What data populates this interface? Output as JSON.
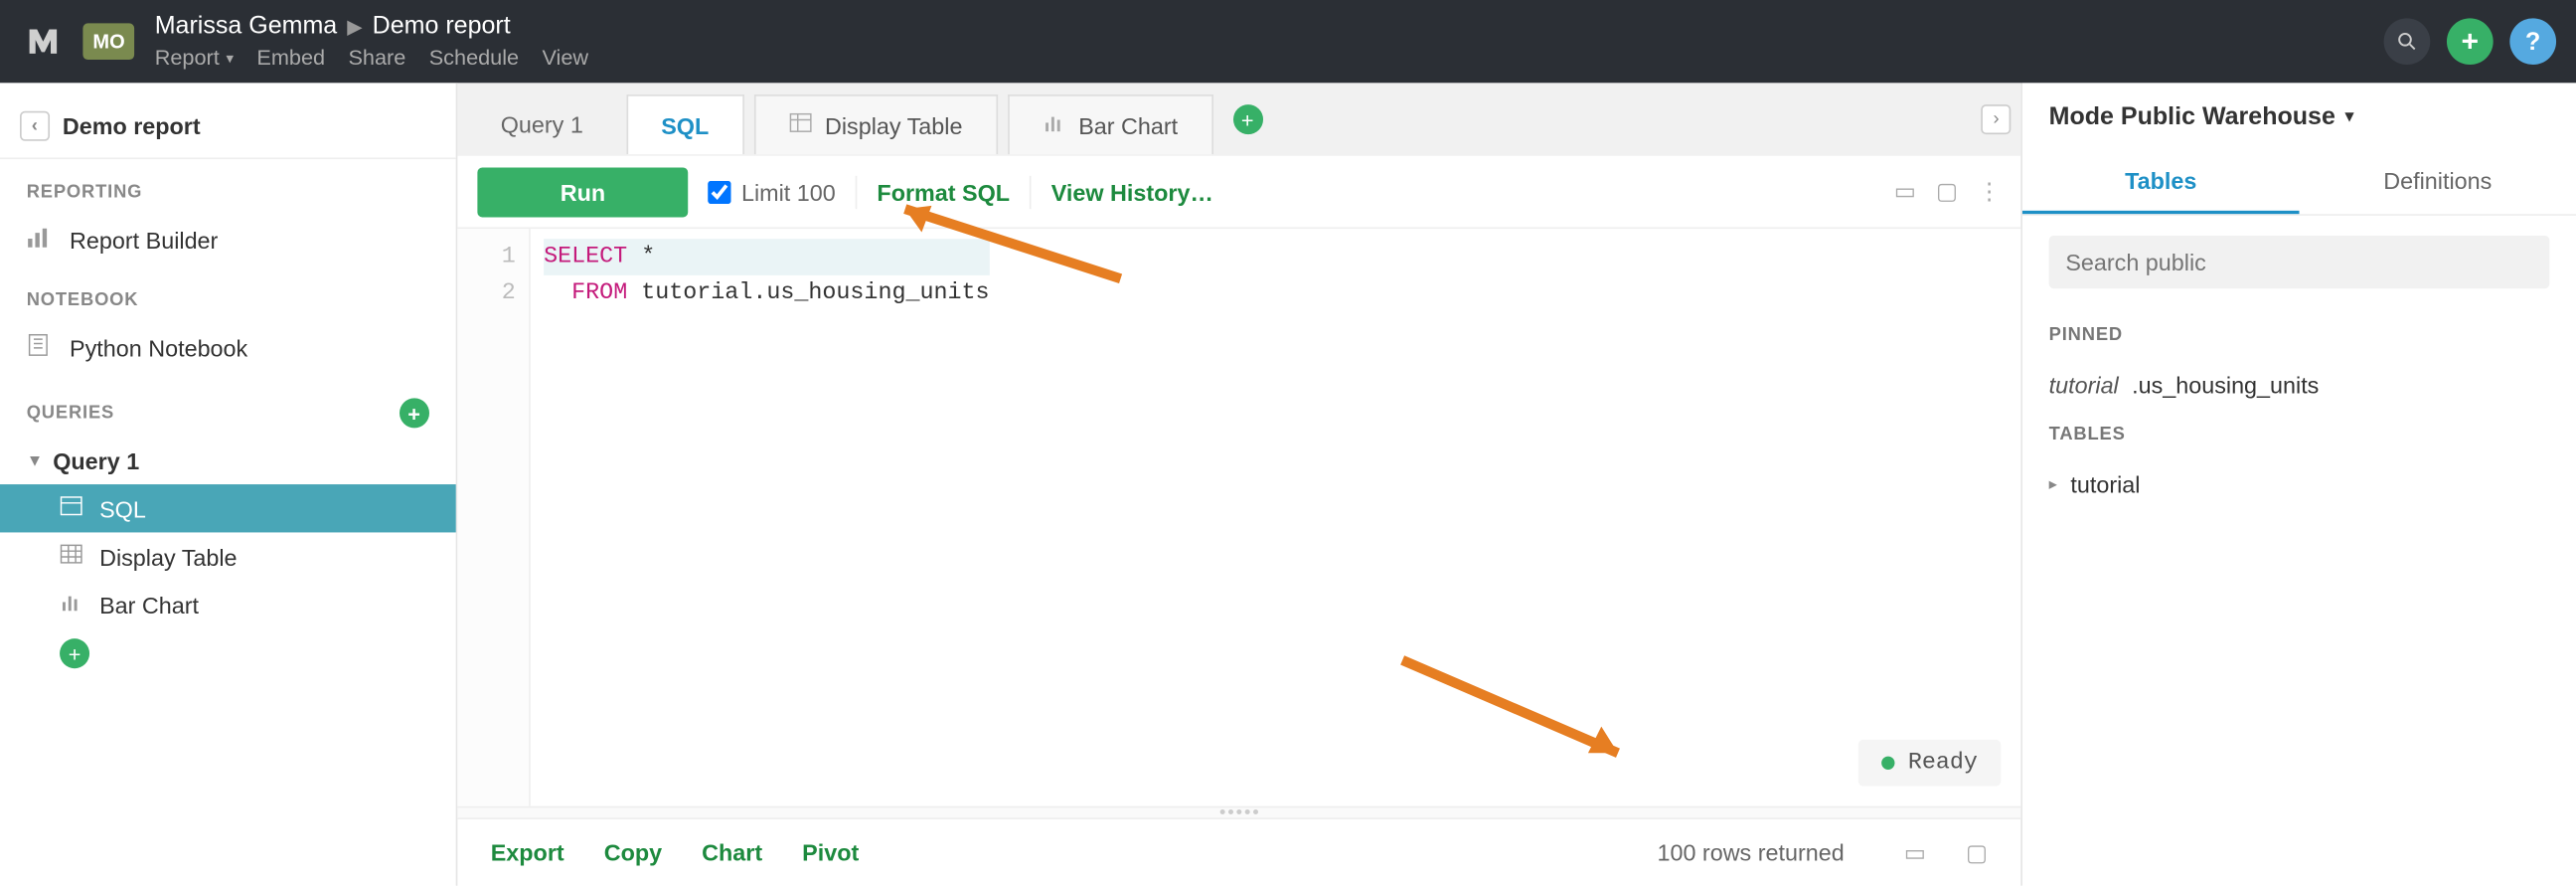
{
  "header": {
    "org_badge": "MO",
    "user": "Marissa Gemma",
    "document": "Demo report",
    "menu": {
      "report": "Report",
      "embed": "Embed",
      "share": "Share",
      "schedule": "Schedule",
      "view": "View"
    }
  },
  "sidebar": {
    "crumb_title": "Demo report",
    "sections": {
      "reporting": "Reporting",
      "notebook": "Notebook",
      "queries": "Queries"
    },
    "items": {
      "report_builder": "Report Builder",
      "python_notebook": "Python Notebook"
    },
    "query": {
      "name": "Query 1",
      "children": {
        "sql": "SQL",
        "display_table": "Display Table",
        "bar_chart": "Bar Chart"
      }
    }
  },
  "tabs": {
    "query1": "Query 1",
    "sql": "SQL",
    "display_table": "Display Table",
    "bar_chart": "Bar Chart"
  },
  "toolbar": {
    "run": "Run",
    "limit_label": "Limit 100",
    "format_sql": "Format SQL",
    "view_history": "View History…"
  },
  "code": {
    "line1_kw": "SELECT",
    "line1_rest": " *",
    "line2_kw": "FROM",
    "line2_rest": " tutorial.us_housing_units",
    "gutter": [
      "1",
      "2"
    ]
  },
  "status": {
    "label": "Ready"
  },
  "results": {
    "export": "Export",
    "copy": "Copy",
    "chart": "Chart",
    "pivot": "Pivot",
    "rows_text": "100 rows returned"
  },
  "right": {
    "connection": "Mode Public Warehouse",
    "tabs": {
      "tables": "Tables",
      "definitions": "Definitions"
    },
    "search_placeholder": "Search public",
    "pinned_hdr": "Pinned",
    "pinned_item_schema": "tutorial",
    "pinned_item_table": ".us_housing_units",
    "tables_hdr": "Tables",
    "schema": "tutorial"
  }
}
